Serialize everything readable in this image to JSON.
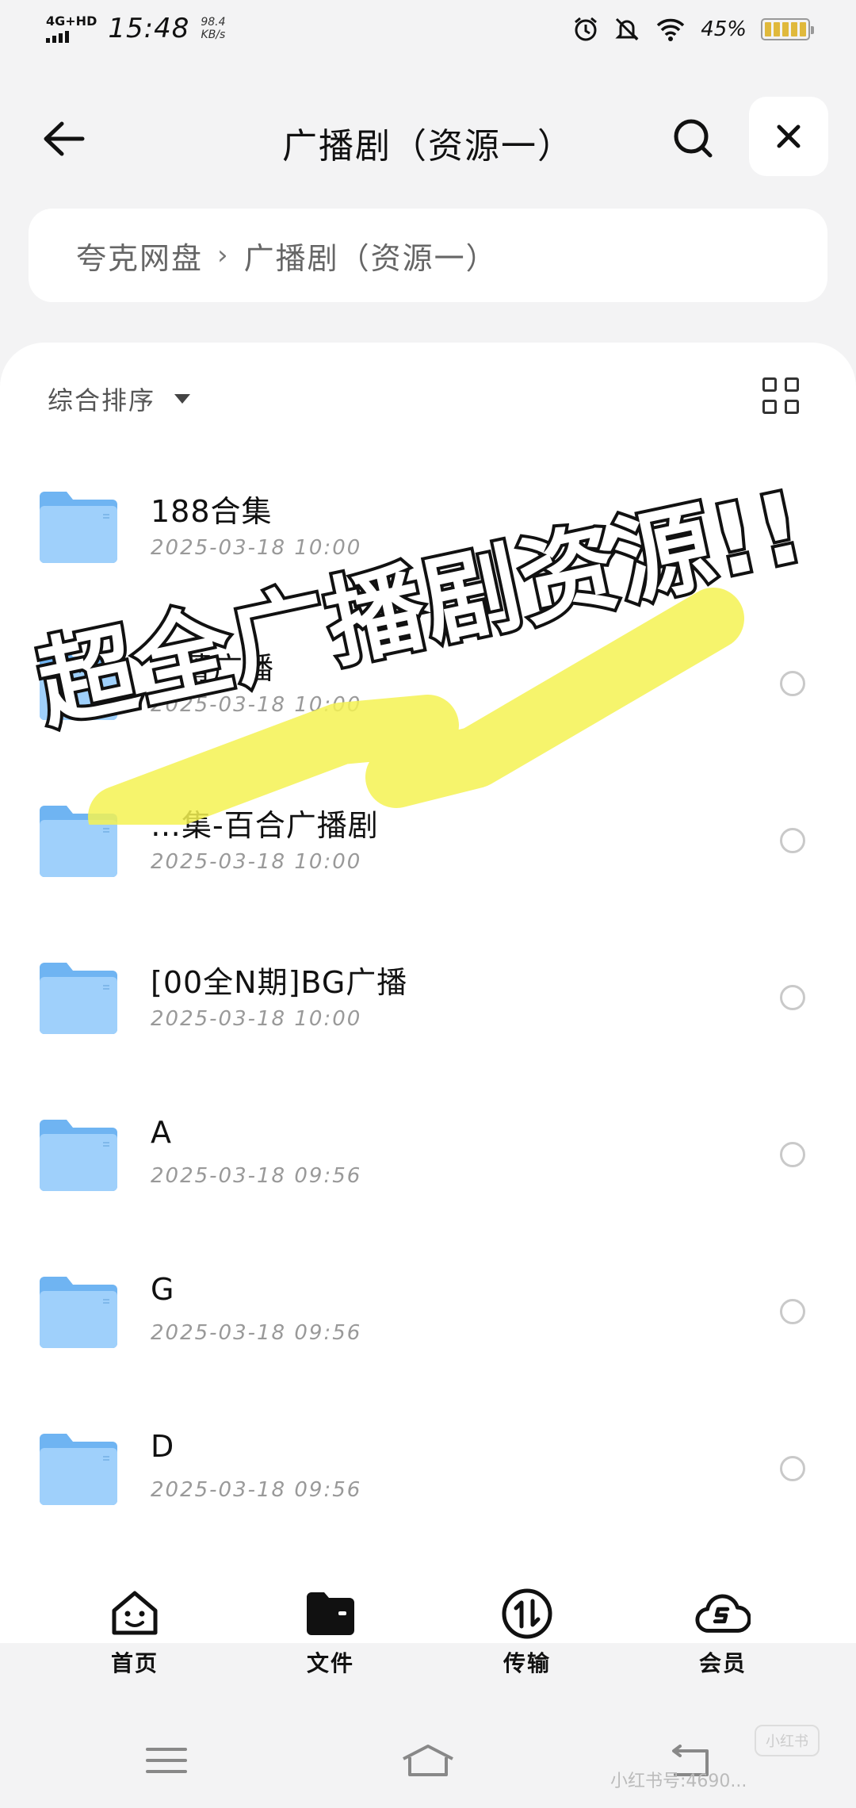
{
  "status_bar": {
    "network": "4G+HD",
    "time": "15:48",
    "speed_value": "98.4",
    "speed_unit": "KB/s",
    "battery_pct": "45%"
  },
  "header": {
    "title": "广播剧（资源一）"
  },
  "breadcrumb": {
    "root": "夸克网盘",
    "current": "广播剧（资源一）"
  },
  "toolbar": {
    "sort_label": "综合排序"
  },
  "files": [
    {
      "name": "188合集",
      "date": "2025-03-18 10:00",
      "has_radio": false
    },
    {
      "name": "…菁广播",
      "date": "2025-03-18 10:00",
      "has_radio": true
    },
    {
      "name": "…集-百合广播剧",
      "date": "2025-03-18 10:00",
      "has_radio": true
    },
    {
      "name": "[00全N期]BG广播",
      "date": "2025-03-18 10:00",
      "has_radio": true
    },
    {
      "name": "A",
      "date": "2025-03-18 09:56",
      "has_radio": true
    },
    {
      "name": "G",
      "date": "2025-03-18 09:56",
      "has_radio": true
    },
    {
      "name": "D",
      "date": "2025-03-18 09:56",
      "has_radio": true
    }
  ],
  "overlay": {
    "text": "超全广播剧资源!!",
    "highlight_color": "#f4f252"
  },
  "tabbar": {
    "home": "首页",
    "files": "文件",
    "transfer": "传输",
    "member": "会员"
  },
  "watermark": {
    "text": "小红书号:4690...",
    "badge": "小红书"
  },
  "colors": {
    "folder": "#6fb4f2",
    "folder_light": "#9fd0fb",
    "background": "#f3f3f4"
  }
}
